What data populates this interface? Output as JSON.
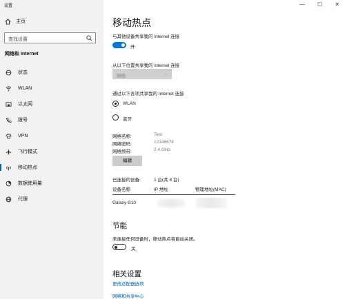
{
  "app_title": "设置",
  "sidebar": {
    "home_label": "主页",
    "search_placeholder": "查找设置",
    "section_title": "网络和 Internet",
    "items": [
      {
        "label": "状态",
        "icon": "status-icon"
      },
      {
        "label": "WLAN",
        "icon": "wifi-icon"
      },
      {
        "label": "以太网",
        "icon": "ethernet-icon"
      },
      {
        "label": "拨号",
        "icon": "dialup-icon"
      },
      {
        "label": "VPN",
        "icon": "vpn-icon"
      },
      {
        "label": "飞行模式",
        "icon": "airplane-icon"
      },
      {
        "label": "移动热点",
        "icon": "hotspot-icon",
        "active": true
      },
      {
        "label": "数据使用量",
        "icon": "data-usage-icon"
      },
      {
        "label": "代理",
        "icon": "proxy-icon"
      }
    ]
  },
  "window_controls": {
    "minimize": "—",
    "maximize": "☐",
    "close": "✕"
  },
  "main": {
    "title": "移动热点",
    "share_label": "与其他设备共享我的 Internet 连接",
    "share_toggle_text": "开",
    "share_from_label": "从以下位置共享我的 Internet 连接",
    "share_from_value": "网络",
    "share_over_label": "通过以下各项共享我的 Internet 连接",
    "option_wlan": "WLAN",
    "option_bluetooth": "蓝牙",
    "props": [
      {
        "key": "网络名称:",
        "value": "Test"
      },
      {
        "key": "网络密码:",
        "value": "12345678"
      },
      {
        "key": "网络频带:",
        "value": "2.4 GHz"
      }
    ],
    "edit_button": "编辑",
    "connected_label": "已连接的设备:",
    "connected_count": "1 台(共 8 台)",
    "table_headers": {
      "name": "设备名称",
      "ip": "IP 地址",
      "mac": "物理地址(MAC)"
    },
    "device_name": "Galaxy-S10",
    "power_title": "节能",
    "power_desc": "未连接任何设备时，移动热点将自动关闭。",
    "power_toggle_text": "关",
    "related_title": "相关设置",
    "link_adapter": "更改适配器选项",
    "link_sharing": "网络和共享中心"
  }
}
